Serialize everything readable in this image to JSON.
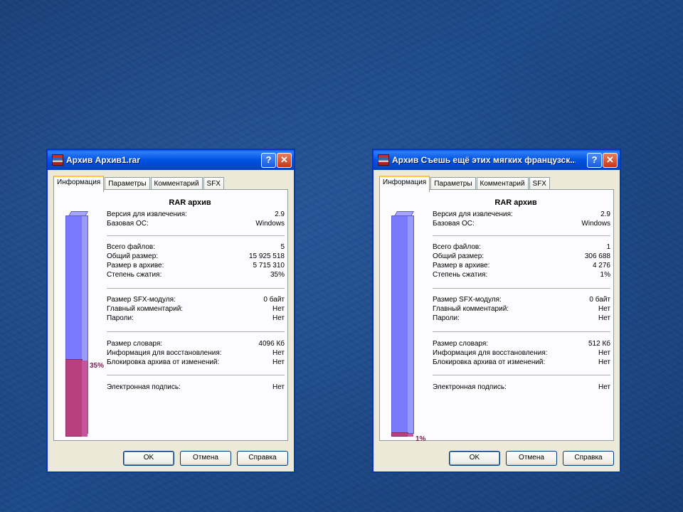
{
  "windows": [
    {
      "title": "Архив Архив1.rar",
      "tabs": [
        "Информация",
        "Параметры",
        "Комментарий",
        "SFX"
      ],
      "heading": "RAR архив",
      "groups": [
        [
          [
            "Версия для извлечения:",
            "2.9"
          ],
          [
            "Базовая ОС:",
            "Windows"
          ]
        ],
        [
          [
            "Всего файлов:",
            "5"
          ],
          [
            "Общий размер:",
            "15 925 518"
          ],
          [
            "Размер в архиве:",
            "5 715 310"
          ],
          [
            "Степень сжатия:",
            "35%"
          ]
        ],
        [
          [
            "Размер SFX-модуля:",
            "0 байт"
          ],
          [
            "Главный комментарий:",
            "Нет"
          ],
          [
            "Пароли:",
            "Нет"
          ]
        ],
        [
          [
            "Размер словаря:",
            "4096 Кб"
          ],
          [
            "Информация для восстановления:",
            "Нет"
          ],
          [
            "Блокировка архива от изменений:",
            "Нет"
          ]
        ],
        [
          [
            "Электронная подпись:",
            "Нет"
          ]
        ]
      ],
      "ratio": 0.35,
      "ratio_label": "35%",
      "buttons": [
        "OK",
        "Отмена",
        "Справка"
      ]
    },
    {
      "title": "Архив Съешь ещё этих мягких французск...",
      "tabs": [
        "Информация",
        "Параметры",
        "Комментарий",
        "SFX"
      ],
      "heading": "RAR архив",
      "groups": [
        [
          [
            "Версия для извлечения:",
            "2.9"
          ],
          [
            "Базовая ОС:",
            "Windows"
          ]
        ],
        [
          [
            "Всего файлов:",
            "1"
          ],
          [
            "Общий размер:",
            "306 688"
          ],
          [
            "Размер в архиве:",
            "4 276"
          ],
          [
            "Степень сжатия:",
            "1%"
          ]
        ],
        [
          [
            "Размер SFX-модуля:",
            "0 байт"
          ],
          [
            "Главный комментарий:",
            "Нет"
          ],
          [
            "Пароли:",
            "Нет"
          ]
        ],
        [
          [
            "Размер словаря:",
            "512 Кб"
          ],
          [
            "Информация для восстановления:",
            "Нет"
          ],
          [
            "Блокировка архива от изменений:",
            "Нет"
          ]
        ],
        [
          [
            "Электронная подпись:",
            "Нет"
          ]
        ]
      ],
      "ratio": 0.01,
      "ratio_label": "1%",
      "buttons": [
        "OK",
        "Отмена",
        "Справка"
      ]
    }
  ],
  "icons": {
    "help": "question-mark-icon",
    "close": "close-x-icon",
    "app": "winrar-books-icon"
  }
}
